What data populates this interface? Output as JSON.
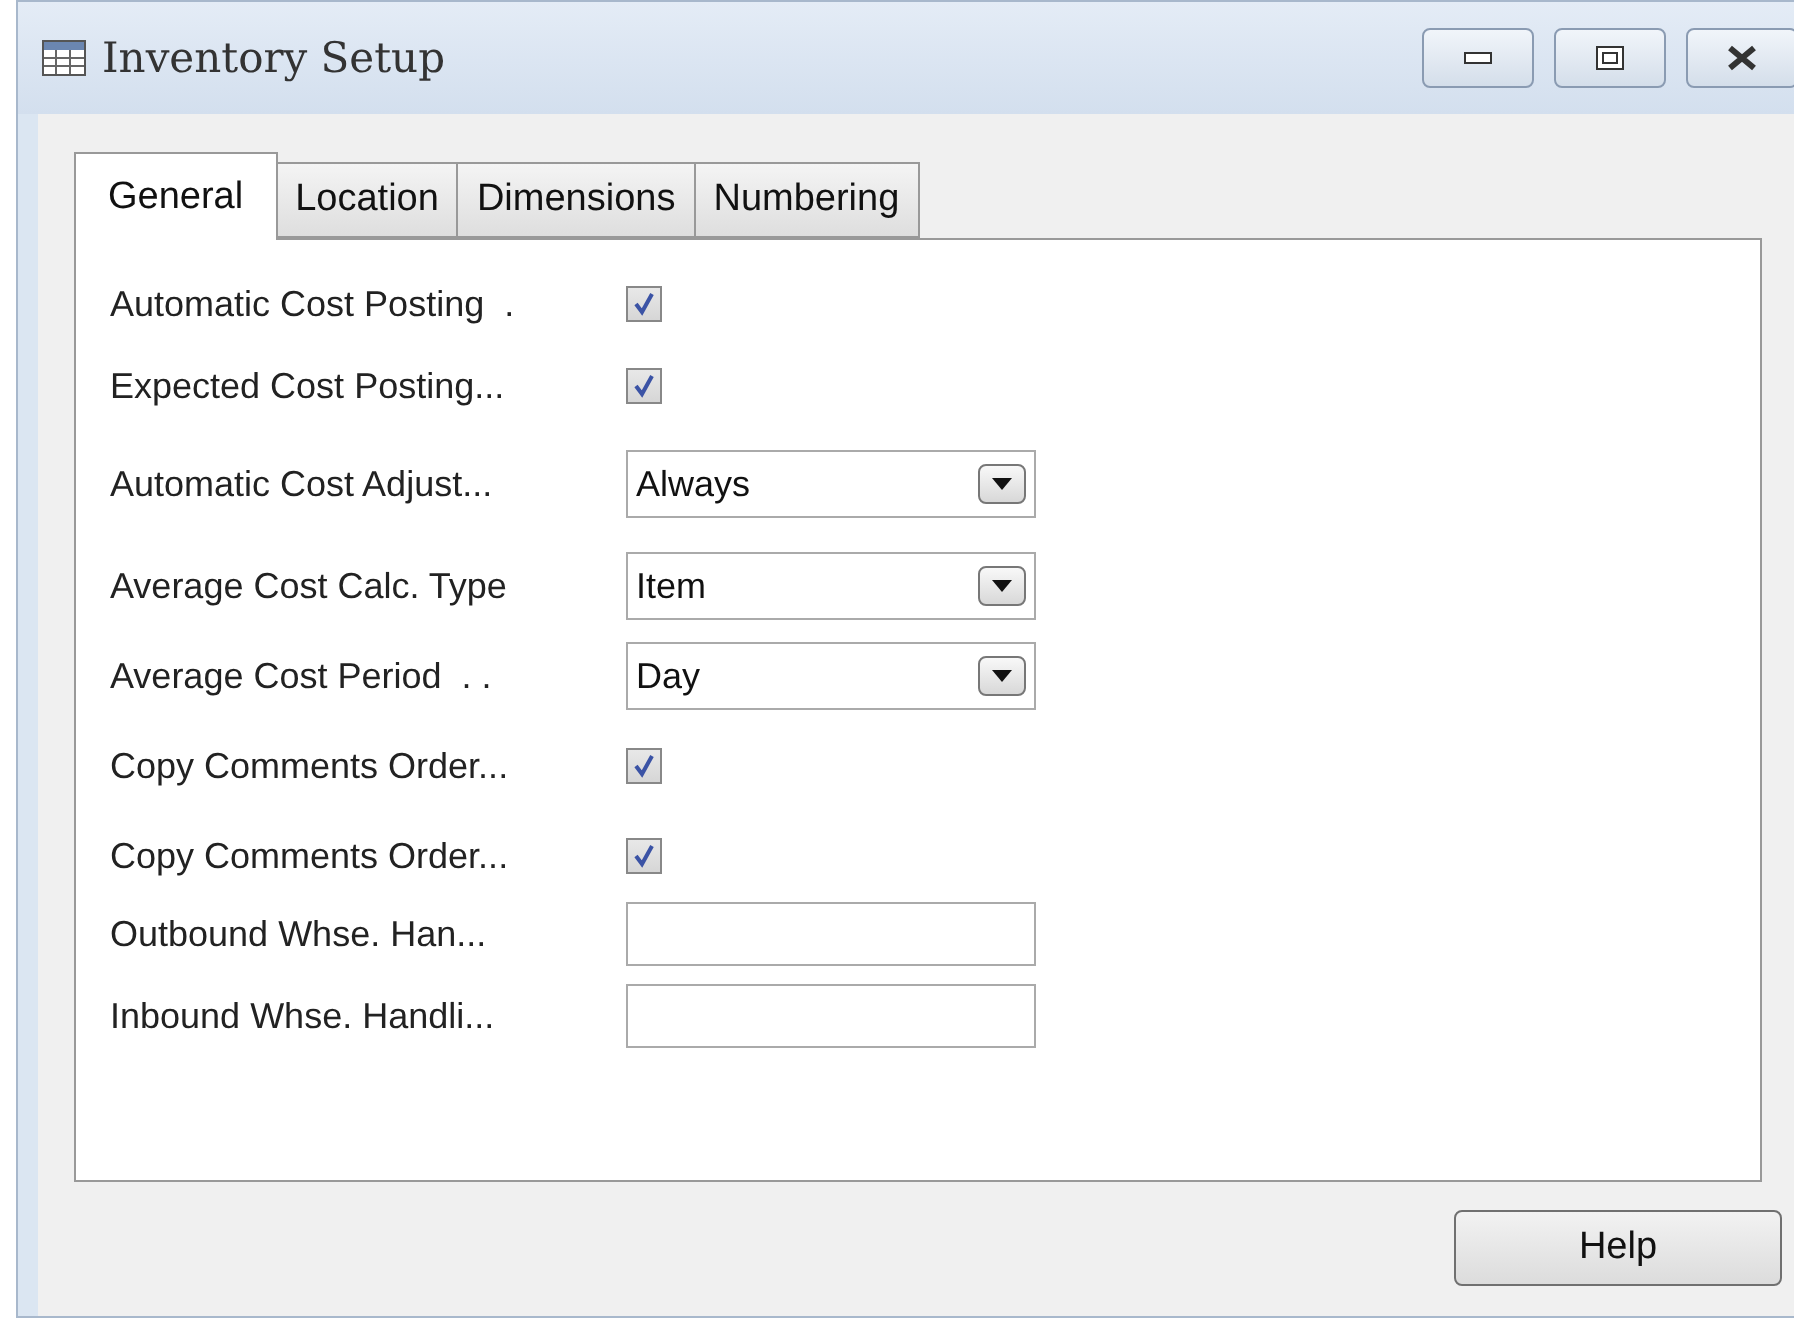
{
  "window": {
    "title": "Inventory Setup"
  },
  "tabs": [
    {
      "label": "General",
      "selected": true
    },
    {
      "label": "Location",
      "selected": false
    },
    {
      "label": "Dimensions",
      "selected": false
    },
    {
      "label": "Numbering",
      "selected": false
    }
  ],
  "fields": [
    {
      "kind": "checkbox",
      "label": "Automatic Cost Posting  .",
      "checked": true
    },
    {
      "kind": "checkbox",
      "label": "Expected Cost Posting...",
      "checked": true
    },
    {
      "kind": "dropdown",
      "label": "Automatic Cost Adjust...",
      "value": "Always"
    },
    {
      "kind": "dropdown",
      "label": "Average Cost Calc. Type",
      "value": "Item"
    },
    {
      "kind": "dropdown",
      "label": "Average Cost Period  . .",
      "value": "Day"
    },
    {
      "kind": "checkbox",
      "label": "Copy Comments Order...",
      "checked": true
    },
    {
      "kind": "checkbox",
      "label": "Copy Comments Order...",
      "checked": true
    },
    {
      "kind": "text",
      "label": "Outbound Whse. Han..."
    },
    {
      "kind": "text",
      "label": "Inbound Whse. Handli..."
    }
  ],
  "buttons": [
    "Help"
  ]
}
